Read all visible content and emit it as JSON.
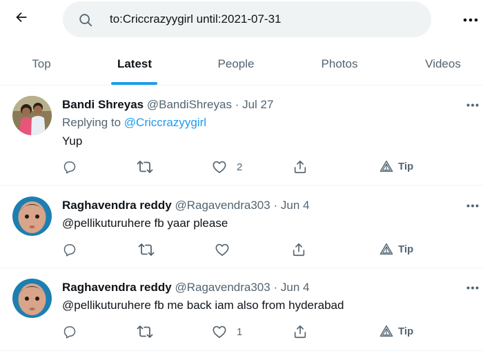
{
  "search": {
    "query": "to:Criccrazyygirl until:2021-07-31"
  },
  "tabs": [
    {
      "label": "Top",
      "active": false
    },
    {
      "label": "Latest",
      "active": true
    },
    {
      "label": "People",
      "active": false
    },
    {
      "label": "Photos",
      "active": false
    },
    {
      "label": "Videos",
      "active": false
    }
  ],
  "tweets": [
    {
      "name": "Bandi Shreyas",
      "handle": "@BandiShreyas",
      "separator": "·",
      "date": "Jul 27",
      "replying_prefix": "Replying to ",
      "replying_to": "@Criccrazyygirl",
      "text": "Yup",
      "reply_count": "",
      "retweet_count": "",
      "like_count": "2",
      "tip_label": "Tip"
    },
    {
      "name": "Raghavendra reddy",
      "handle": "@Ragavendra303",
      "separator": "·",
      "date": "Jun 4",
      "text": "@pellikuturuhere fb yaar please",
      "reply_count": "",
      "retweet_count": "",
      "like_count": "",
      "tip_label": "Tip"
    },
    {
      "name": "Raghavendra reddy",
      "handle": "@Ragavendra303",
      "separator": "·",
      "date": "Jun 4",
      "text": "@pellikuturuhere fb me back iam also from hyderabad",
      "reply_count": "",
      "retweet_count": "",
      "like_count": "1",
      "tip_label": "Tip"
    }
  ],
  "icons": {
    "back": "arrow-left-icon",
    "search": "search-icon",
    "more": "more-horizontal-icon",
    "reply": "reply-icon",
    "retweet": "retweet-icon",
    "like": "heart-icon",
    "share": "share-icon",
    "tip": "tip-icon"
  },
  "colors": {
    "accent": "#1d9bf0",
    "text_primary": "#0f1419",
    "text_secondary": "#536471",
    "search_bg": "#eff3f4"
  }
}
